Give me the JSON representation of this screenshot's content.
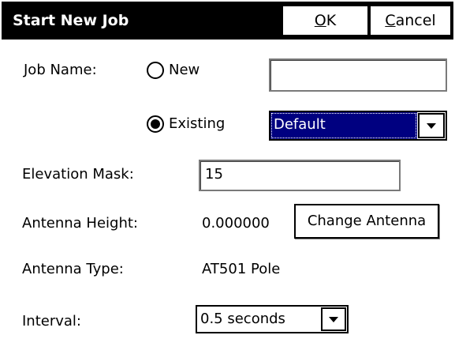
{
  "window": {
    "title": "Start New Job",
    "ok_label": "OK",
    "ok_accel": "O",
    "ok_rest": "K",
    "cancel_label": "Cancel",
    "cancel_accel": "C",
    "cancel_rest": "ancel"
  },
  "job_name": {
    "label": "Job Name:",
    "option_new": {
      "label": "New",
      "selected": false
    },
    "new_name_value": "",
    "option_existing": {
      "label": "Existing",
      "selected": true
    },
    "existing_value": "Default"
  },
  "elevation_mask": {
    "label": "Elevation Mask:",
    "value": "15"
  },
  "antenna_height": {
    "label": "Antenna Height:",
    "value": "0.000000",
    "change_button": "Change Antenna"
  },
  "antenna_type": {
    "label": "Antenna Type:",
    "value": "AT501 Pole"
  },
  "interval": {
    "label": "Interval:",
    "value": "0.5 seconds"
  },
  "colors": {
    "titlebar": "#000000",
    "selection": "#000080"
  },
  "icons": {
    "dropdown": "triangle-down"
  }
}
